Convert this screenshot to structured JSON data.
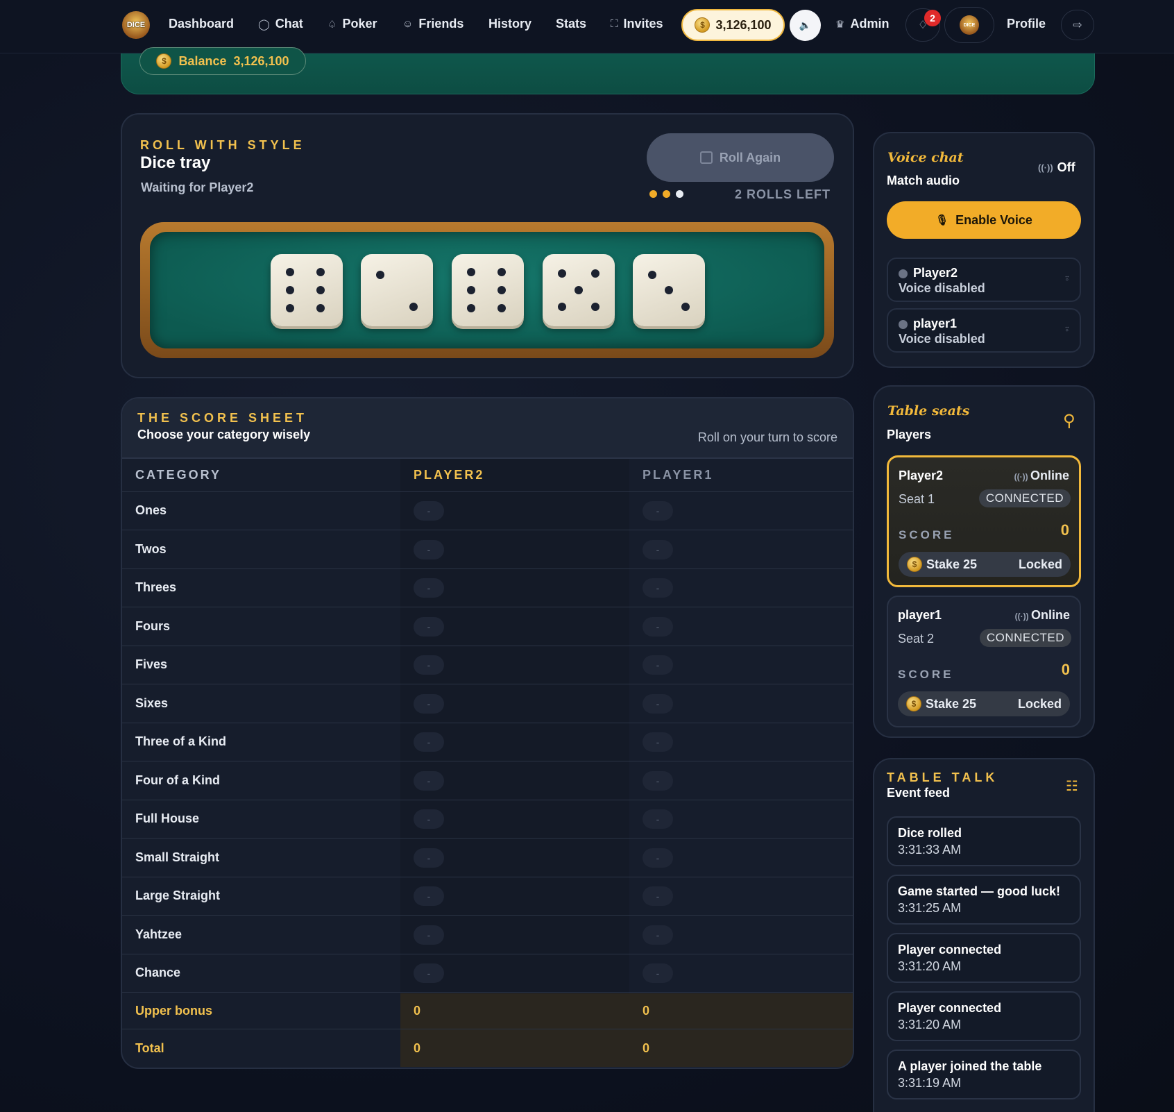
{
  "nav": {
    "logo_text": "DICE",
    "items": [
      {
        "label": "Dashboard",
        "icon": ""
      },
      {
        "label": "Chat",
        "icon": "chat-bubble-icon"
      },
      {
        "label": "Poker",
        "icon": "spade-icon"
      },
      {
        "label": "Friends",
        "icon": "users-icon"
      },
      {
        "label": "History",
        "icon": ""
      },
      {
        "label": "Stats",
        "icon": ""
      },
      {
        "label": "Invites",
        "icon": "gamepad-icon"
      }
    ],
    "coins": "3,126,100",
    "admin_label": "Admin",
    "notifications_count": "2",
    "profile_label": "Profile"
  },
  "banner": {
    "balance_label": "Balance",
    "balance_value": "3,126,100"
  },
  "dice_tray": {
    "eyebrow": "ROLL WITH STYLE",
    "title": "Dice tray",
    "status": "Waiting for Player2",
    "roll_button": "Roll Again",
    "rolls_left": "2 ROLLS LEFT",
    "roll_dots": [
      "#f2ac28",
      "#f2ac28",
      "#e8ecf3"
    ],
    "dice": [
      6,
      2,
      6,
      5,
      3
    ]
  },
  "score_sheet": {
    "eyebrow": "THE SCORE SHEET",
    "subtitle": "Choose your category wisely",
    "hint": "Roll on your turn to score",
    "columns": [
      "CATEGORY",
      "PLAYER2",
      "PLAYER1"
    ],
    "rows": [
      {
        "category": "Ones",
        "player2": "-",
        "player1": "-"
      },
      {
        "category": "Twos",
        "player2": "-",
        "player1": "-"
      },
      {
        "category": "Threes",
        "player2": "-",
        "player1": "-"
      },
      {
        "category": "Fours",
        "player2": "-",
        "player1": "-"
      },
      {
        "category": "Fives",
        "player2": "-",
        "player1": "-"
      },
      {
        "category": "Sixes",
        "player2": "-",
        "player1": "-"
      },
      {
        "category": "Three of a Kind",
        "player2": "-",
        "player1": "-"
      },
      {
        "category": "Four of a Kind",
        "player2": "-",
        "player1": "-"
      },
      {
        "category": "Full House",
        "player2": "-",
        "player1": "-"
      },
      {
        "category": "Small Straight",
        "player2": "-",
        "player1": "-"
      },
      {
        "category": "Large Straight",
        "player2": "-",
        "player1": "-"
      },
      {
        "category": "Yahtzee",
        "player2": "-",
        "player1": "-"
      },
      {
        "category": "Chance",
        "player2": "-",
        "player1": "-"
      }
    ],
    "upper_bonus": {
      "label": "Upper bonus",
      "player2": "0",
      "player1": "0"
    },
    "total": {
      "label": "Total",
      "player2": "0",
      "player1": "0"
    }
  },
  "voice_chat": {
    "eyebrow": "Voice chat",
    "title": "Match audio",
    "status": "Off",
    "enable_button": "Enable Voice",
    "participants": [
      {
        "name": "Player2",
        "status": "Voice disabled"
      },
      {
        "name": "player1",
        "status": "Voice disabled"
      }
    ]
  },
  "table_seats": {
    "eyebrow": "Table seats",
    "title": "Players",
    "players": [
      {
        "name": "Player2",
        "online": "Online",
        "seat": "Seat 1",
        "connection": "CONNECTED",
        "score_label": "SCORE",
        "score": "0",
        "stake": "Stake 25",
        "stake_status": "Locked"
      },
      {
        "name": "player1",
        "online": "Online",
        "seat": "Seat 2",
        "connection": "CONNECTED",
        "score_label": "SCORE",
        "score": "0",
        "stake": "Stake 25",
        "stake_status": "Locked"
      }
    ]
  },
  "table_talk": {
    "eyebrow": "TABLE TALK",
    "title": "Event feed",
    "events": [
      {
        "text": "Dice rolled",
        "time": "3:31:33 AM"
      },
      {
        "text": "Game started — good luck!",
        "time": "3:31:25 AM"
      },
      {
        "text": "Player connected",
        "time": "3:31:20 AM"
      },
      {
        "text": "Player connected",
        "time": "3:31:20 AM"
      },
      {
        "text": "A player joined the table",
        "time": "3:31:19 AM"
      }
    ]
  }
}
